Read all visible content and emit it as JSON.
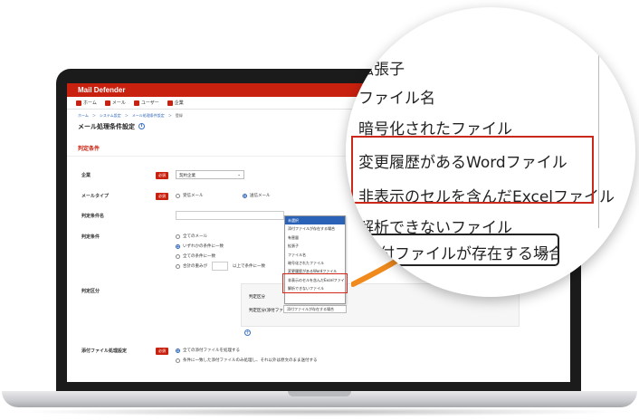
{
  "app": {
    "title": "Mail Defender"
  },
  "nav": [
    {
      "label": "ホーム"
    },
    {
      "label": "メール"
    },
    {
      "label": "ユーザー"
    },
    {
      "label": "企業"
    }
  ],
  "breadcrumb": [
    "ホーム",
    "＞",
    "システム設定",
    "＞",
    "メール処理条件設定",
    "＞",
    "登録"
  ],
  "page": {
    "title": "メール処理条件設定",
    "info_icon": "i"
  },
  "section": {
    "title": "判定条件"
  },
  "required_label": "必須",
  "form": {
    "company": {
      "label": "企業",
      "value": "契約企業"
    },
    "mail_type": {
      "label": "メールタイプ",
      "options": [
        "受信メール",
        "送信メール"
      ],
      "selected": 1
    },
    "condition_name": {
      "label": "判定条件名"
    },
    "condition": {
      "label": "判定条件",
      "options": [
        "全てのメール",
        "いずれかの条件に一致",
        "全ての条件に一致",
        "合計の重みが"
      ],
      "selected": 1,
      "suffix": "以上で条件に一致"
    },
    "category": {
      "label": "判定区分",
      "sub1": "判定区分",
      "sub2": "判定区分(添付ファイル)",
      "value": "添付ファイルが存在する場合"
    },
    "action": {
      "label": "添付ファイル処理設定",
      "options": [
        "全ての添付ファイルを処理する",
        "条件に一致した添付ファイルのみ処理し、それ以外は原文のまま送付する"
      ],
      "selected": 0
    }
  },
  "dropdown_items": [
    "未選択",
    "添付ファイルが存在する場合",
    "拡張子",
    "ファイル名",
    "暗号化されたファイル",
    "変更履歴があるWordファイル",
    "非表示のセルを含んだExcelファイル",
    "解析できないファイル"
  ],
  "dropdown_short": [
    "未選択",
    "添付ファイルが存在する場合",
    "有害量",
    "拡張子",
    "ファイル名",
    "暗号化されたファイル",
    "変更履歴があるWordファイル",
    "非表示のセルを含んだExcelファイル",
    "解析できないファイル"
  ],
  "magnifier": {
    "items": [
      "拡張子",
      "ファイル名",
      "暗号化されたファイル",
      "変更履歴があるWordファイル",
      "非表示のセルを含んだExcelファイル",
      "解析できないファイル"
    ],
    "select_value": "添付ファイルが存在する場合"
  },
  "colors": {
    "brand": "#c9210f",
    "link": "#2a62b8",
    "highlight": "#c9281a",
    "arrow": "#f08a1c"
  }
}
